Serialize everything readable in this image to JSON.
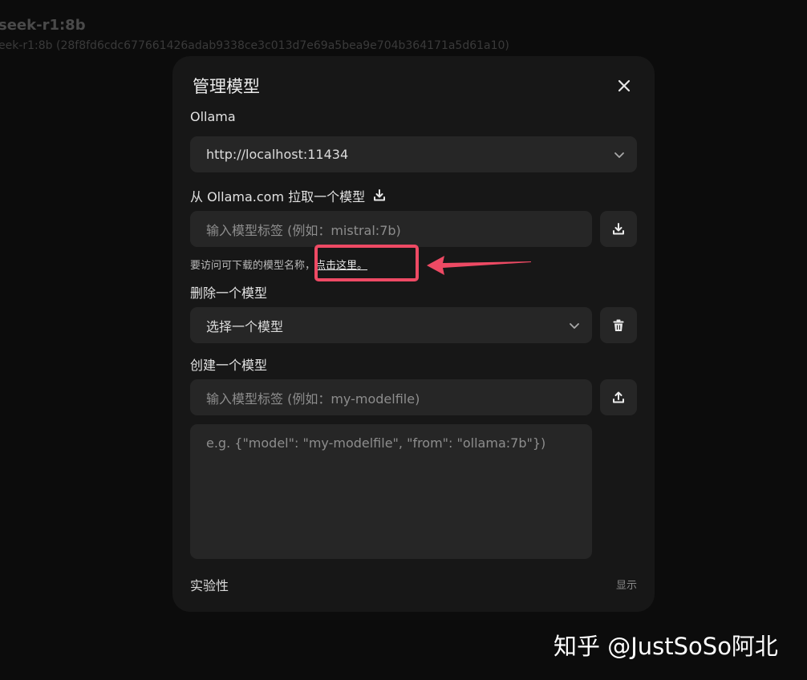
{
  "background": {
    "title": "seek-r1:8b",
    "subtitle": "eek-r1:8b (28f8fd6cdc677661426adab9338ce3c013d7e69a5bea9e704b364171a5d61a10)"
  },
  "modal": {
    "title": "管理模型",
    "close_icon": "close-icon",
    "provider_label": "Ollama",
    "server_url": "http://localhost:11434",
    "pull": {
      "label": "从 Ollama.com 拉取一个模型",
      "label_icon": "download-icon",
      "input_placeholder": "输入模型标签 (例如：mistral:7b)",
      "button_icon": "download-icon",
      "hint_prefix": "要访问可下载的模型名称，",
      "hint_link": "点击这里。"
    },
    "delete": {
      "label": "删除一个模型",
      "select_placeholder": "选择一个模型",
      "button_icon": "trash-icon"
    },
    "create": {
      "label": "创建一个模型",
      "input_placeholder": "输入模型标签 (例如：my-modelfile)",
      "button_icon": "upload-icon",
      "textarea_placeholder": "e.g. {\"model\": \"my-modelfile\", \"from\": \"ollama:7b\"})"
    },
    "experimental": {
      "label": "实验性",
      "toggle": "显示"
    }
  },
  "annotation": {
    "color": "#ee4a64"
  },
  "watermark": "知乎 @JustSoSo阿北"
}
